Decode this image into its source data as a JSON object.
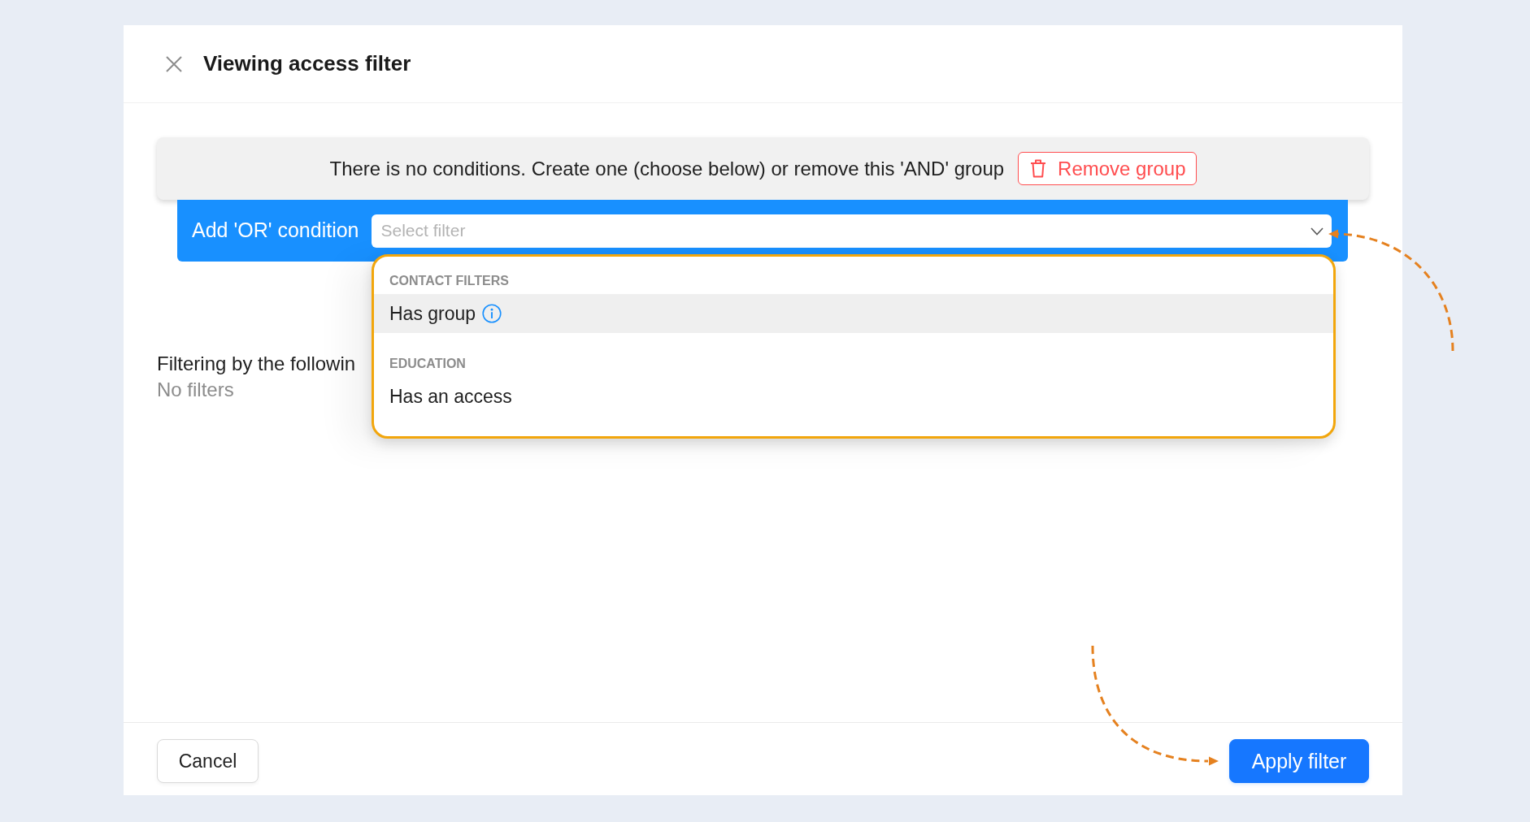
{
  "dialog": {
    "title": "Viewing access filter"
  },
  "condition_group": {
    "message": "There is no conditions. Create one (choose below) or remove this 'AND' group",
    "remove_button": "Remove group"
  },
  "or_condition": {
    "label": "Add 'OR' condition",
    "select": {
      "placeholder": "Select filter",
      "expanded": true,
      "groups": [
        {
          "heading": "CONTACT FILTERS",
          "options": [
            {
              "label": "Has group",
              "info": true,
              "highlighted": true
            }
          ]
        },
        {
          "heading": "EDUCATION",
          "options": [
            {
              "label": "Has an access",
              "info": false,
              "highlighted": false
            }
          ]
        }
      ]
    }
  },
  "summary": {
    "heading": "Filtering by the followin",
    "empty_text": "No filters"
  },
  "footer": {
    "buttons": [
      {
        "label": "Cancel",
        "kind": "secondary"
      },
      {
        "label": "Apply filter",
        "kind": "primary"
      }
    ]
  }
}
